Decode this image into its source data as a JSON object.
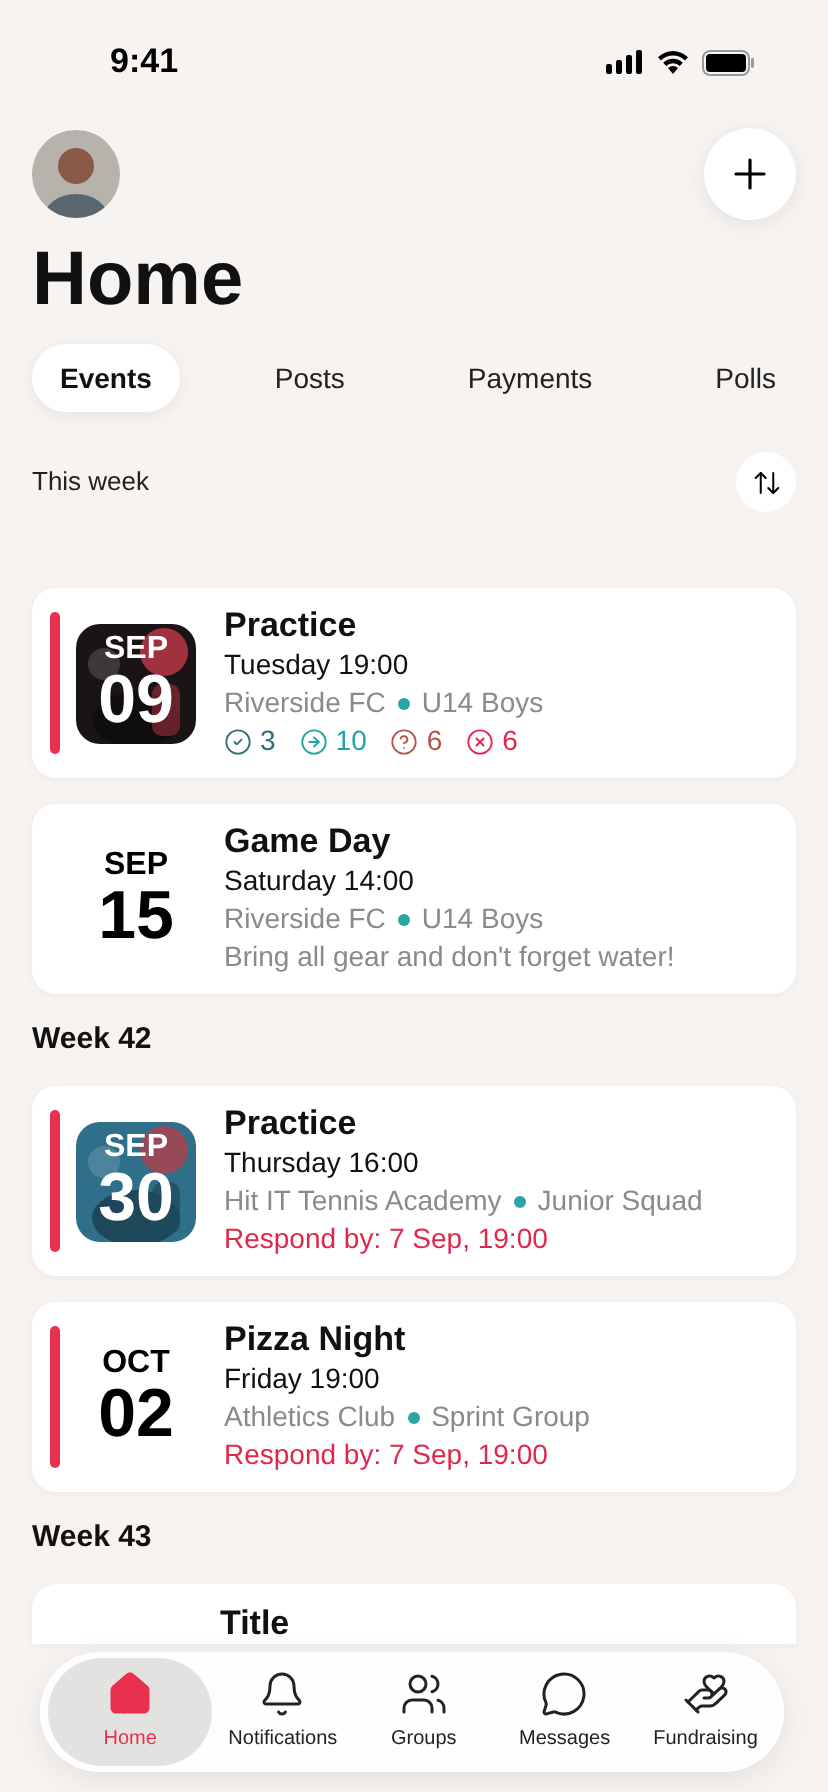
{
  "status_bar": {
    "time": "9:41"
  },
  "header": {
    "title": "Home"
  },
  "tabs": [
    {
      "label": "Events",
      "selected": true
    },
    {
      "label": "Posts",
      "selected": false
    },
    {
      "label": "Payments",
      "selected": false
    },
    {
      "label": "Polls",
      "selected": false
    }
  ],
  "sections": [
    {
      "heading": "This week",
      "kind": "current",
      "events": [
        {
          "title": "Practice",
          "accent": true,
          "tile": {
            "kind": "picture"
          },
          "month": "SEP",
          "day": "09",
          "time": "Tuesday 19:00",
          "club": "Riverside FC",
          "group": "U14 Boys",
          "counts": [
            {
              "kind": "accepted",
              "value": "3",
              "color": "#2f6f73"
            },
            {
              "kind": "arrived",
              "value": "10",
              "color": "#1fa3a6"
            },
            {
              "kind": "unknown",
              "value": "6",
              "color": "#b5544f"
            },
            {
              "kind": "declined",
              "value": "6",
              "color": "#e0284a"
            }
          ]
        },
        {
          "title": "Game Day",
          "accent": false,
          "tile": {
            "kind": "plain"
          },
          "month": "SEP",
          "day": "15",
          "time": "Saturday 14:00",
          "club": "Riverside FC",
          "group": "U14 Boys",
          "note": "Bring all gear and don't forget water!"
        }
      ]
    },
    {
      "heading": "Week 42",
      "kind": "week",
      "events": [
        {
          "title": "Practice",
          "accent": true,
          "tile": {
            "kind": "picture"
          },
          "month": "SEP",
          "day": "30",
          "time": "Thursday 16:00",
          "club": "Hit IT Tennis Academy",
          "group": "Junior Squad",
          "respond_by": "Respond by: 7 Sep, 19:00"
        },
        {
          "title": "Pizza Night",
          "accent": true,
          "tile": {
            "kind": "plain"
          },
          "month": "OCT",
          "day": "02",
          "time": "Friday 19:00",
          "club": "Athletics Club",
          "group": "Sprint Group",
          "respond_by": "Respond by: 7 Sep, 19:00"
        }
      ]
    },
    {
      "heading": "Week 43",
      "kind": "week",
      "events": [
        {
          "title": "Title",
          "accent": false
        }
      ]
    }
  ],
  "nav": [
    {
      "kind": "home",
      "label": "Home",
      "selected": true
    },
    {
      "kind": "bell",
      "label": "Notifications",
      "selected": false
    },
    {
      "kind": "people",
      "label": "Groups",
      "selected": false
    },
    {
      "kind": "chat",
      "label": "Messages",
      "selected": false
    },
    {
      "kind": "hand",
      "label": "Fundraising",
      "selected": false
    }
  ]
}
